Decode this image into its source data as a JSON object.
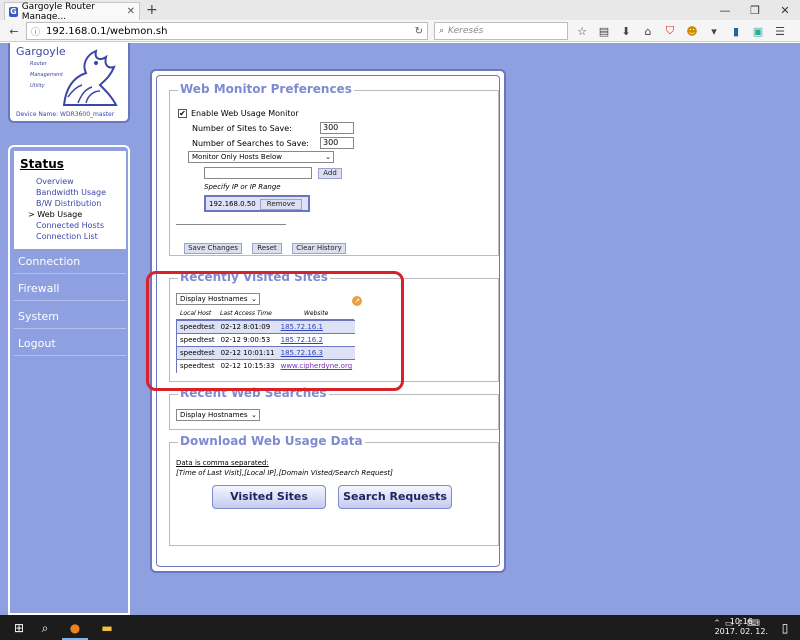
{
  "browser": {
    "tab_title": "Gargoyle Router Manage...",
    "favicon_letter": "G",
    "url": "192.168.0.1/webmon.sh",
    "search_placeholder": "Keresés",
    "tab_close_icon": "close-icon",
    "new_tab_icon": "plus-icon",
    "toolbar_icons": [
      "star-icon",
      "reading-list-icon",
      "download-icon",
      "home-icon",
      "ublock-icon",
      "extension-icon",
      "chevron-down-icon",
      "extension-icon-2",
      "extension-icon-3",
      "menu-icon"
    ]
  },
  "sidebar": {
    "brand": "Gargoyle",
    "brand_sub": [
      "Router",
      "Management",
      "Utility"
    ],
    "device_name": "Device Name:  WDR3600_master",
    "status_heading": "Status",
    "status_items": [
      {
        "label": "Overview"
      },
      {
        "label": "Bandwidth Usage"
      },
      {
        "label": "B/W Distribution"
      },
      {
        "label": "> Web Usage"
      },
      {
        "label": "Connected Hosts"
      },
      {
        "label": "Connection List"
      }
    ],
    "main_items": [
      "Connection",
      "Firewall",
      "System",
      "Logout"
    ]
  },
  "prefs": {
    "title": "Web Monitor Preferences",
    "enable_label": "Enable Web Usage Monitor",
    "enable_checked": "✔",
    "sites_label": "Number of Sites to Save:",
    "sites_value": "300",
    "searches_label": "Number of Searches to Save:",
    "searches_value": "300",
    "monitor_select": "Monitor Only Hosts Below",
    "add_button": "Add",
    "ip_hint": "Specify IP or IP Range",
    "ip_entry": "192.168.0.50",
    "remove_button": "Remove",
    "save_button": "Save Changes",
    "reset_button": "Reset",
    "clear_button": "Clear History"
  },
  "recent_sites": {
    "title": "Recently Visited Sites",
    "display_select": "Display Hostnames",
    "headers": [
      "Local Host",
      "Last Access Time",
      "Website"
    ],
    "rows": [
      {
        "host": "speedtest",
        "time": "02-12 8:01:09",
        "site": "185.72.16.1"
      },
      {
        "host": "speedtest",
        "time": "02-12 9:00:53",
        "site": "185.72.16.2"
      },
      {
        "host": "speedtest",
        "time": "02-12 10:01:11",
        "site": "185.72.16.3"
      },
      {
        "host": "speedtest",
        "time": "02-12 10:15:33",
        "site": "www.cipherdyne.org"
      }
    ]
  },
  "recent_searches": {
    "title": "Recent Web Searches",
    "display_select": "Display Hostnames"
  },
  "download": {
    "title": "Download Web Usage Data",
    "note": "Data is comma separated:",
    "format": "[Time of Last Visit],[Local IP],[Domain Visted/Search Request]",
    "visited_button": "Visited Sites",
    "search_button": "Search Requests"
  },
  "taskbar": {
    "time": "10:16",
    "date": "2017. 02. 12."
  }
}
